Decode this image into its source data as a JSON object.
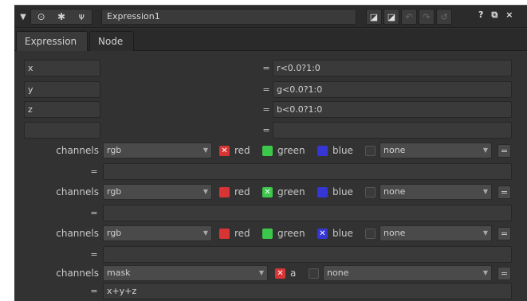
{
  "titlebar": {
    "node_name": "Expression1",
    "help_label": "?",
    "float_label": "⧉",
    "close_label": "×"
  },
  "tabs": [
    {
      "label": "Expression"
    },
    {
      "label": "Node"
    }
  ],
  "temp_vars": [
    {
      "name": "x",
      "eq": "=",
      "expr": "r<0.0?1:0"
    },
    {
      "name": "y",
      "eq": "=",
      "expr": "g<0.0?1:0"
    },
    {
      "name": "z",
      "eq": "=",
      "expr": "b<0.0?1:0"
    },
    {
      "name": "",
      "eq": "=",
      "expr": ""
    }
  ],
  "channel_groups": [
    {
      "label": "channels",
      "layer": "rgb",
      "ch1": "red",
      "ch2": "green",
      "ch3": "blue",
      "extra": "none",
      "eq": "=",
      "expr": ""
    },
    {
      "label": "channels",
      "layer": "rgb",
      "ch1": "red",
      "ch2": "green",
      "ch3": "blue",
      "extra": "none",
      "eq": "=",
      "expr": ""
    },
    {
      "label": "channels",
      "layer": "rgb",
      "ch1": "red",
      "ch2": "green",
      "ch3": "blue",
      "extra": "none",
      "eq": "=",
      "expr": ""
    },
    {
      "label": "channels",
      "layer": "mask",
      "ch1": "a",
      "extra": "none",
      "eq": "=",
      "expr": "x+y+z"
    }
  ],
  "eq_button_label": "=",
  "icons": {
    "collapse": "triangle-down-icon",
    "viewer": "circle-dot-icon",
    "gear": "gear-icon",
    "wrench": "wrench-icon"
  },
  "colors": {
    "red_channel": "#d83434",
    "green_channel": "#3cc84a",
    "blue_channel": "#3636d4",
    "panel_bg": "#323232"
  }
}
